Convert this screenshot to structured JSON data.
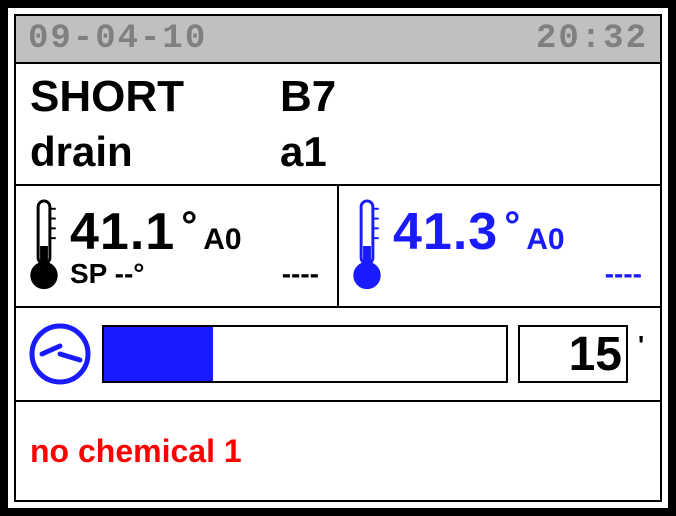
{
  "header": {
    "date": "09-04-10",
    "time": "20:32"
  },
  "program": {
    "name": "SHORT",
    "code": "B7",
    "step": "drain",
    "step_code": "a1"
  },
  "temp_left": {
    "value": "41.1",
    "degree": "°",
    "unit": "A0",
    "sp_label": "SP",
    "sp_value": "--°",
    "extra": "----"
  },
  "temp_right": {
    "value": "41.3",
    "degree": "°",
    "unit": "A0",
    "extra": "----"
  },
  "timer": {
    "progress_percent": 27,
    "remaining": "15"
  },
  "status": {
    "message": "no chemical 1"
  }
}
